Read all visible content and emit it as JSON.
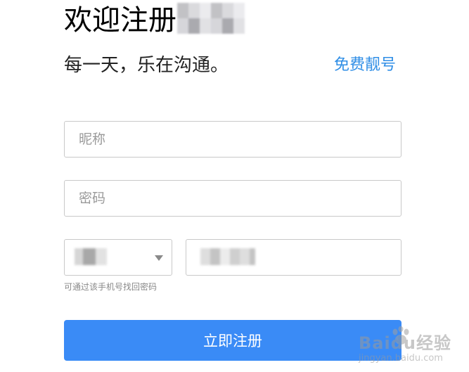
{
  "header": {
    "title": "欢迎注册",
    "subtitle": "每一天，乐在沟通。",
    "vip_link": "免费靓号"
  },
  "form": {
    "nickname_placeholder": "昵称",
    "password_placeholder": "密码",
    "phone_hint": "可通过该手机号找回密码",
    "submit_label": "立即注册"
  },
  "watermark": {
    "brand": "Baidu经验",
    "url": "jingyan.baidu.com"
  },
  "colors": {
    "accent": "#3a8bf6",
    "link": "#2f8ee6",
    "border": "#c9c9c9"
  }
}
